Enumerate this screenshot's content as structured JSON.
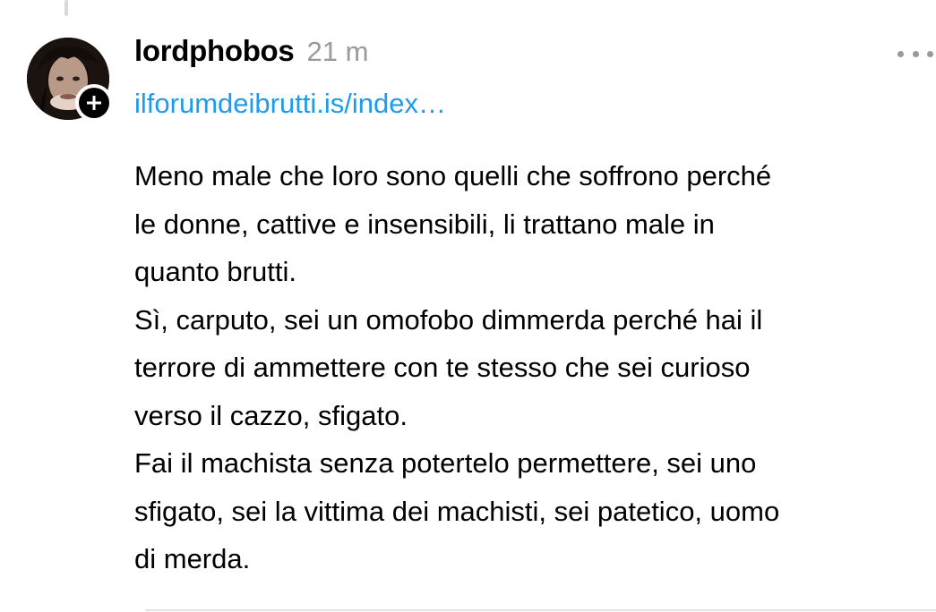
{
  "post": {
    "username": "lordphobos",
    "timestamp": "21 m",
    "link_text": "ilforumdeibrutti.is/index…",
    "body_lines": [
      "Meno male che loro sono quelli che soffrono perché",
      "le donne, cattive e insensibili, li trattano male in",
      "quanto brutti.",
      "Sì, carputo, sei un omofobo dimmerda perché hai il",
      "terrore di ammettere con te stesso che sei curioso",
      "verso il cazzo, sfigato.",
      "Fai il machista senza potertelo permettere, sei uno",
      "sfigato, sei la vittima dei machisti, sei patetico, uomo",
      "di merda."
    ]
  },
  "icons": {
    "follow": "plus-icon",
    "more": "more-horizontal-icon"
  },
  "colors": {
    "link": "#1d9bf0",
    "secondary_text": "#9a9a9a",
    "text": "#000000",
    "background": "#ffffff"
  }
}
